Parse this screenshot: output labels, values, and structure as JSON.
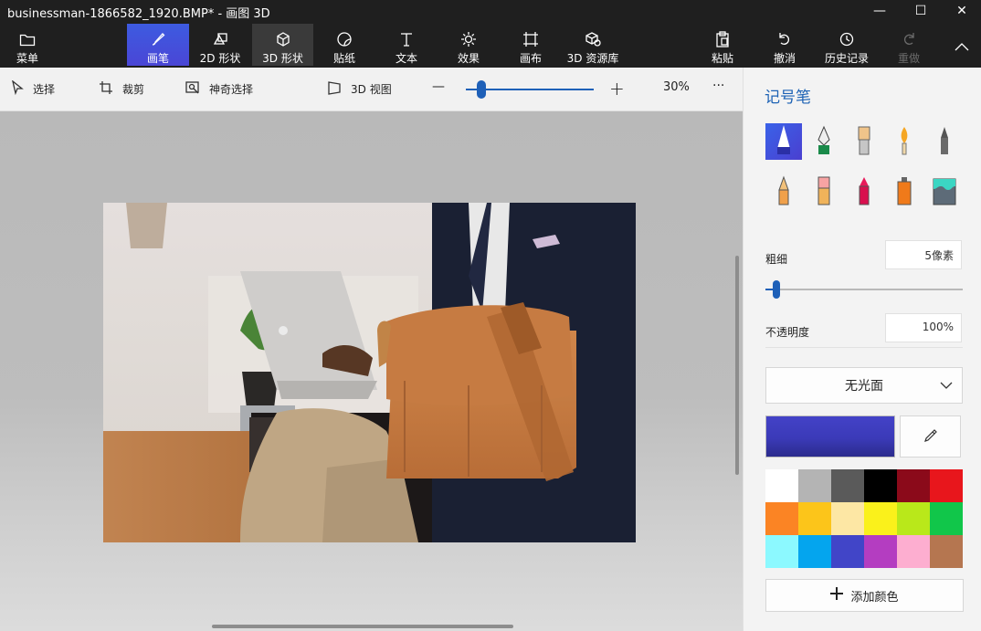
{
  "window": {
    "title": "businessman-1866582_1920.BMP* - 画图 3D",
    "minimize_glyph": "—",
    "maximize_glyph": "☐",
    "close_glyph": "✕"
  },
  "ribbon": {
    "menu": "菜单",
    "brushes": "画笔",
    "shapes2d": "2D 形状",
    "shapes3d": "3D 形状",
    "stickers": "贴纸",
    "text": "文本",
    "effects": "效果",
    "canvas": "画布",
    "library3d": "3D 资源库",
    "paste": "粘贴",
    "undo": "撤消",
    "history": "历史记录",
    "redo": "重做"
  },
  "toolbar": {
    "select": "选择",
    "crop": "裁剪",
    "magic_select": "神奇选择",
    "view3d": "3D 视图",
    "zoom_minus": "—",
    "zoom_plus": "+",
    "zoom_percent": "30%",
    "zoom_level": 0.14,
    "more": "···"
  },
  "panel": {
    "title": "记号笔",
    "thickness_label": "粗细",
    "thickness_value": "5像素",
    "thickness_level": 0.04,
    "opacity_label": "不透明度",
    "opacity_value": "100%",
    "opacity_level": 1.0,
    "finish": "无光面",
    "add_color": "添加颜色",
    "current_color": "#4342c7",
    "palette": [
      "#ffffff",
      "#b4b4b4",
      "#5a5a5a",
      "#000000",
      "#8b0a1a",
      "#e8161c",
      "#fb8424",
      "#fcc51a",
      "#fde7a4",
      "#faf11b",
      "#b9e81a",
      "#11c64a",
      "#8cf9ff",
      "#04a5ee",
      "#4145c8",
      "#b43dc1",
      "#fdaed0",
      "#b57650"
    ]
  }
}
